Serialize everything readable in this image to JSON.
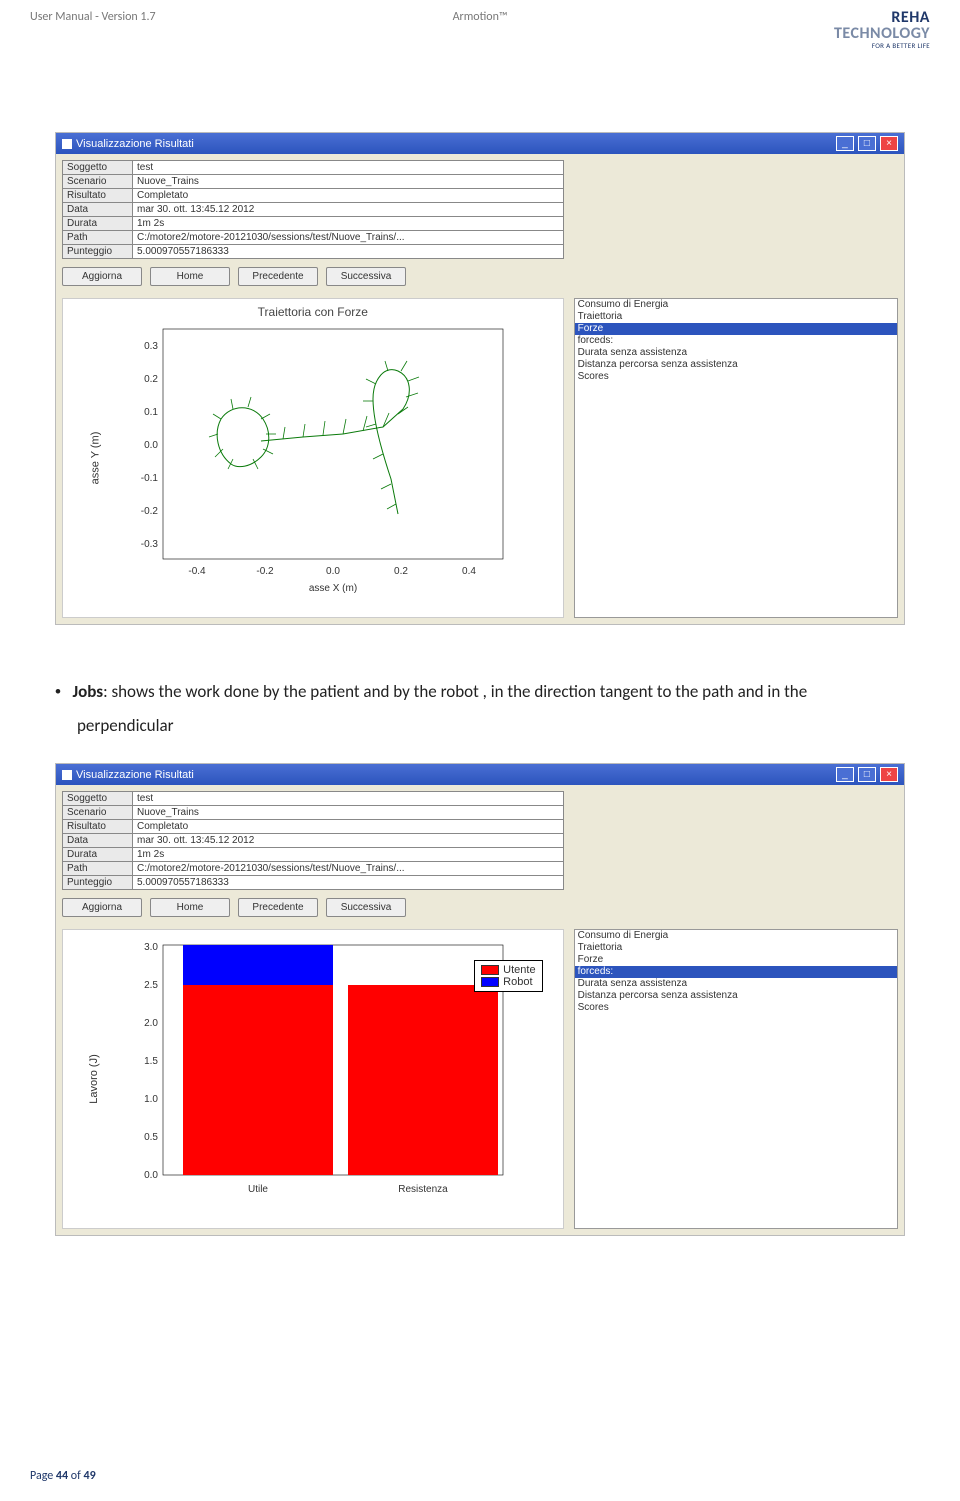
{
  "header": {
    "left": "User Manual - Version 1.7",
    "center": "Armotion™",
    "logo_top": "REHA",
    "logo_bottom": "TECHNOLOGY",
    "logo_tag": "FOR A BETTER LIFE"
  },
  "screenshot_common": {
    "window_title": "Visualizzazione Risultati",
    "info_rows": [
      {
        "label": "Soggetto",
        "value": "test"
      },
      {
        "label": "Scenario",
        "value": "Nuove_Trains"
      },
      {
        "label": "Risultato",
        "value": "Completato"
      },
      {
        "label": "Data",
        "value": "mar 30. ott. 13:45.12 2012"
      },
      {
        "label": "Durata",
        "value": "1m 2s"
      },
      {
        "label": "Path",
        "value": "C:/motore2/motore-20121030/sessions/test/Nuove_Trains/..."
      },
      {
        "label": "Punteggio",
        "value": "5.000970557186333"
      }
    ],
    "buttons": {
      "b0": "Aggiorna",
      "b1": "Home",
      "b2": "Precedente",
      "b3": "Successiva"
    }
  },
  "screenshot1": {
    "plot_title": "Traiettoria con Forze",
    "ylabel": "asse Y (m)",
    "xlabel": "asse X (m)",
    "side_items": {
      "i0": "Consumo di Energia",
      "i1": "Traiettoria",
      "i2": "Forze",
      "i3": "forceds:",
      "i4": "Durata senza assistenza",
      "i5": "Distanza percorsa senza assistenza",
      "i6": "Scores"
    },
    "selected": "i2",
    "chart_data": {
      "type": "line",
      "title": "Traiettoria con Forze",
      "xlabel": "asse X (m)",
      "ylabel": "asse Y (m)",
      "xlim": [
        -0.5,
        0.5
      ],
      "ylim": [
        -0.35,
        0.35
      ],
      "xticks": [
        -0.4,
        -0.2,
        0.0,
        0.2,
        0.4
      ],
      "yticks": [
        -0.3,
        -0.2,
        -0.1,
        0.0,
        0.1,
        0.2,
        0.3
      ],
      "trajectory_approx": [
        [
          -0.3,
          -0.05
        ],
        [
          -0.33,
          0.0
        ],
        [
          -0.34,
          0.05
        ],
        [
          -0.32,
          0.1
        ],
        [
          -0.28,
          0.12
        ],
        [
          -0.23,
          0.11
        ],
        [
          -0.2,
          0.08
        ],
        [
          -0.18,
          0.04
        ],
        [
          -0.18,
          -0.02
        ],
        [
          -0.2,
          -0.07
        ],
        [
          -0.25,
          -0.09
        ],
        [
          -0.3,
          -0.05
        ],
        [
          -0.2,
          0.03
        ],
        [
          -0.1,
          0.04
        ],
        [
          0.0,
          0.05
        ],
        [
          0.1,
          0.07
        ],
        [
          0.18,
          0.12
        ],
        [
          0.22,
          0.18
        ],
        [
          0.21,
          0.23
        ],
        [
          0.16,
          0.25
        ],
        [
          0.12,
          0.2
        ],
        [
          0.12,
          0.12
        ],
        [
          0.14,
          0.04
        ],
        [
          0.17,
          -0.05
        ],
        [
          0.18,
          -0.15
        ]
      ],
      "note": "Green trajectory with many short force vectors along the path"
    }
  },
  "screenshot2": {
    "ylabel": "Lavoro (J)",
    "legend": {
      "l0": "Utente",
      "l1": "Robot"
    },
    "xcat": {
      "c0": "Utile",
      "c1": "Resistenza"
    },
    "side_items": {
      "i0": "Consumo di Energia",
      "i1": "Traiettoria",
      "i2": "Forze",
      "i3": "forceds:",
      "i4": "Durata senza assistenza",
      "i5": "Distanza percorsa senza assistenza",
      "i6": "Scores"
    },
    "selected": "i3",
    "chart_data": {
      "type": "bar",
      "stacked": true,
      "ylabel": "Lavoro (J)",
      "categories": [
        "Utile",
        "Resistenza"
      ],
      "series": [
        {
          "name": "Utente",
          "color": "#ff0000",
          "values": [
            2.5,
            2.5
          ]
        },
        {
          "name": "Robot",
          "color": "#0000ff",
          "values": [
            0.5,
            0.0
          ]
        }
      ],
      "ylim": [
        0.0,
        3.0
      ],
      "yticks": [
        0.0,
        0.5,
        1.0,
        1.5,
        2.0,
        2.5,
        3.0
      ]
    }
  },
  "paragraph": {
    "bullet": "•",
    "label": "Jobs",
    "rest": ": shows the work done by the patient and by the robot , in the direction tangent to the path and in the perpendicular"
  },
  "footer": {
    "prefix": "Page ",
    "cur": "44",
    "mid": " of ",
    "total": "49"
  }
}
